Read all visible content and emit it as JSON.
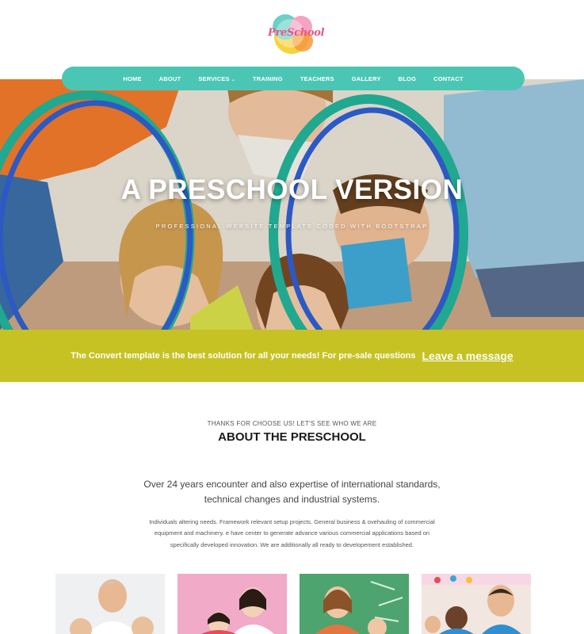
{
  "brand": {
    "logo_text": "PreSchool"
  },
  "nav": {
    "items": [
      {
        "label": "HOME"
      },
      {
        "label": "ABOUT"
      },
      {
        "label": "SERVICES",
        "has_dropdown": true,
        "dropdown_icon": "chevron-down-icon"
      },
      {
        "label": "TRAINING"
      },
      {
        "label": "TEACHERS"
      },
      {
        "label": "GALLERY"
      },
      {
        "label": "BLOG"
      },
      {
        "label": "CONTACT"
      }
    ]
  },
  "hero": {
    "title": "A PRESCHOOL VERSION",
    "subtitle": "PROFESSIONAL WEBSITE TEMPLATE CODED WITH BOOTSTRAP"
  },
  "banner": {
    "text": "The Convert template is the best solution for all your needs! For pre-sale questions",
    "link": "Leave a message"
  },
  "about": {
    "kicker": "THANKS FOR CHOOSE US! LET'S SEE WHO WE ARE",
    "title": "ABOUT THE PRESCHOOL",
    "lead": "Over 24 years encounter and also expertise of international standards, technical changes and industrial systems.",
    "body": "Individuals altering needs. Framework relevant setup projects. General business & ovehauling of commercial equipment and machinery. e have center to generate advance various commercial applications based on specifically developed innovation. We are additionally all ready to developement established."
  },
  "colors": {
    "nav_bg": "#4cc6b4",
    "banner_bg": "#c6c223",
    "logo_pink": "#e8558a"
  }
}
